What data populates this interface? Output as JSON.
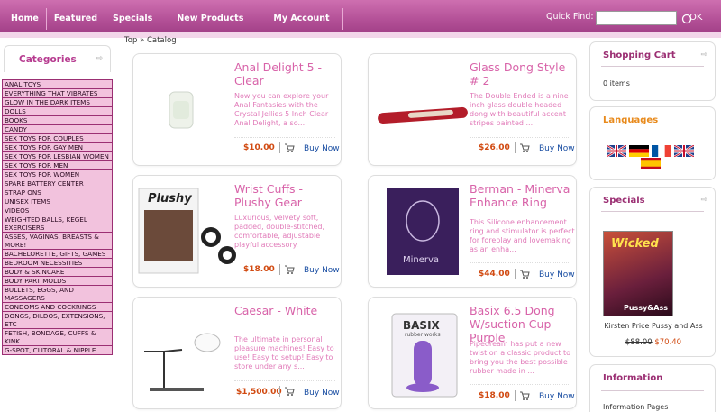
{
  "nav": [
    "Home",
    "Featured",
    "Specials",
    "New Products",
    "My Account"
  ],
  "search": {
    "label": "Quick Find:",
    "value": "",
    "ok": "OK"
  },
  "categories": {
    "title": "Categories",
    "items": [
      "Anal Toys",
      "Everything that Vibrates",
      "Glow In the Dark Items",
      "Dolls",
      "Books",
      "Candy",
      "Sex Toys for Couples",
      "Sex Toys for Gay Men",
      "Sex Toys for Lesbian Women",
      "Sex Toys for Men",
      "Sex Toys for Women",
      "Spare Battery Center",
      "Strap Ons",
      "Unisex Items",
      "Videos",
      "Weighted Balls, Kegel Exercisers",
      "Asses, Vaginas, Breasts & More!",
      "Bachelorette, Gifts, Games",
      "Bedroom Necessities",
      "Body & Skincare",
      "Body Part Molds",
      "Bullets, Eggs, and Massagers",
      "Condoms and Cockrings",
      "Dongs, Dildos, Extensions, etc",
      "Fetish, Bondage, Cuffs & Kink",
      "G-Spot, Clitoral & Nipple"
    ]
  },
  "breadcrumb": [
    "Top",
    "»",
    "Catalog"
  ],
  "products": [
    {
      "title": "Anal Delight 5 - Clear",
      "desc": "Now you can explore your Anal Fantasies with the Crystal Jellies 5 Inch Clear Anal Delight, a so...",
      "price": "$10.00",
      "buy": "Buy Now"
    },
    {
      "title": "Glass Dong Style # 2",
      "desc": "The Double Ended is a nine inch glass double headed dong with beautiful accent stripes painted ...",
      "price": "$26.00",
      "buy": "Buy Now"
    },
    {
      "title": "Wrist Cuffs - Plushy Gear",
      "desc": "Luxurious, velvety soft, padded, double-stitched, comfortable, adjustable playful accessory.",
      "price": "$18.00",
      "buy": "Buy Now"
    },
    {
      "title": "Berman - Minerva Enhance Ring",
      "desc": "This Silicone enhancement ring and stimulator is perfect for foreplay and lovemaking as an enha...",
      "price": "$44.00",
      "buy": "Buy Now"
    },
    {
      "title": "Caesar - White",
      "desc": "The ultimate in personal pleasure machines! Easy to use! Easy to setup! Easy to store under any s...",
      "price": "$1,500.00",
      "buy": "Buy Now"
    },
    {
      "title": "Basix 6.5 Dong W/suction Cup - Purple",
      "desc": "Pipedream has put a new twist on a classic product to bring you the best possible rubber made in ...",
      "price": "$18.00",
      "buy": "Buy Now"
    }
  ],
  "package_labels": {
    "plushy": "Plushy",
    "minerva": "Minerva",
    "basix": "BASIX",
    "basix_sub": "rubber works"
  },
  "cart": {
    "title": "Shopping Cart",
    "items": "0 items"
  },
  "languages": {
    "title": "Languages"
  },
  "specials": {
    "title": "Specials",
    "product": "Kirsten Price Pussy and Ass",
    "old_price": "$88.00",
    "new_price": "$70.40",
    "cover_text": "Wicked",
    "cover_sub": "Pussy&Ass"
  },
  "information": {
    "title": "Information",
    "first_link": "Information Pages"
  },
  "colors": {
    "brand": "#b24f96",
    "title_pink": "#d863a9",
    "price": "#d14a11",
    "link": "#1b4fa3",
    "category_bg": "#f2c2dd"
  }
}
